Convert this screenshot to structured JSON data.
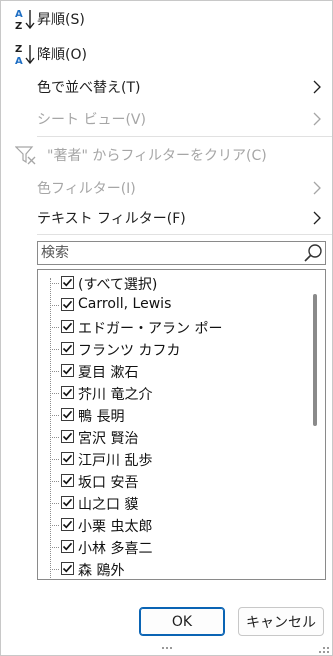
{
  "menu": {
    "sort_asc": "昇順(S)",
    "sort_desc": "降順(O)",
    "sort_by_color": "色で並べ替え(T)",
    "sheet_view": "シート ビュー(V)",
    "clear_filter": "\"著者\" からフィルターをクリア(C)",
    "color_filter": "色フィルター(I)",
    "text_filter": "テキスト フィルター(F)"
  },
  "search": {
    "placeholder": "検索"
  },
  "list": {
    "items": [
      {
        "label": "(すべて選択)",
        "checked": true
      },
      {
        "label": "Carroll, Lewis",
        "checked": true
      },
      {
        "label": "エドガー・アラン ポー",
        "checked": true
      },
      {
        "label": "フランツ カフカ",
        "checked": true
      },
      {
        "label": "夏目 漱石",
        "checked": true
      },
      {
        "label": "芥川 竜之介",
        "checked": true
      },
      {
        "label": "鴨 長明",
        "checked": true
      },
      {
        "label": "宮沢 賢治",
        "checked": true
      },
      {
        "label": "江戸川 乱歩",
        "checked": true
      },
      {
        "label": "坂口 安吾",
        "checked": true
      },
      {
        "label": "山之口 貘",
        "checked": true
      },
      {
        "label": "小栗 虫太郎",
        "checked": true
      },
      {
        "label": "小林 多喜二",
        "checked": true
      },
      {
        "label": "森 鴎外",
        "checked": true
      }
    ]
  },
  "buttons": {
    "ok": "OK",
    "cancel": "キャンセル"
  },
  "colors": {
    "accent": "#0a64b4",
    "disabled_text": "#a6a6a6",
    "sort_a": "#1f1f1f",
    "sort_z": "#1f6fc4"
  }
}
